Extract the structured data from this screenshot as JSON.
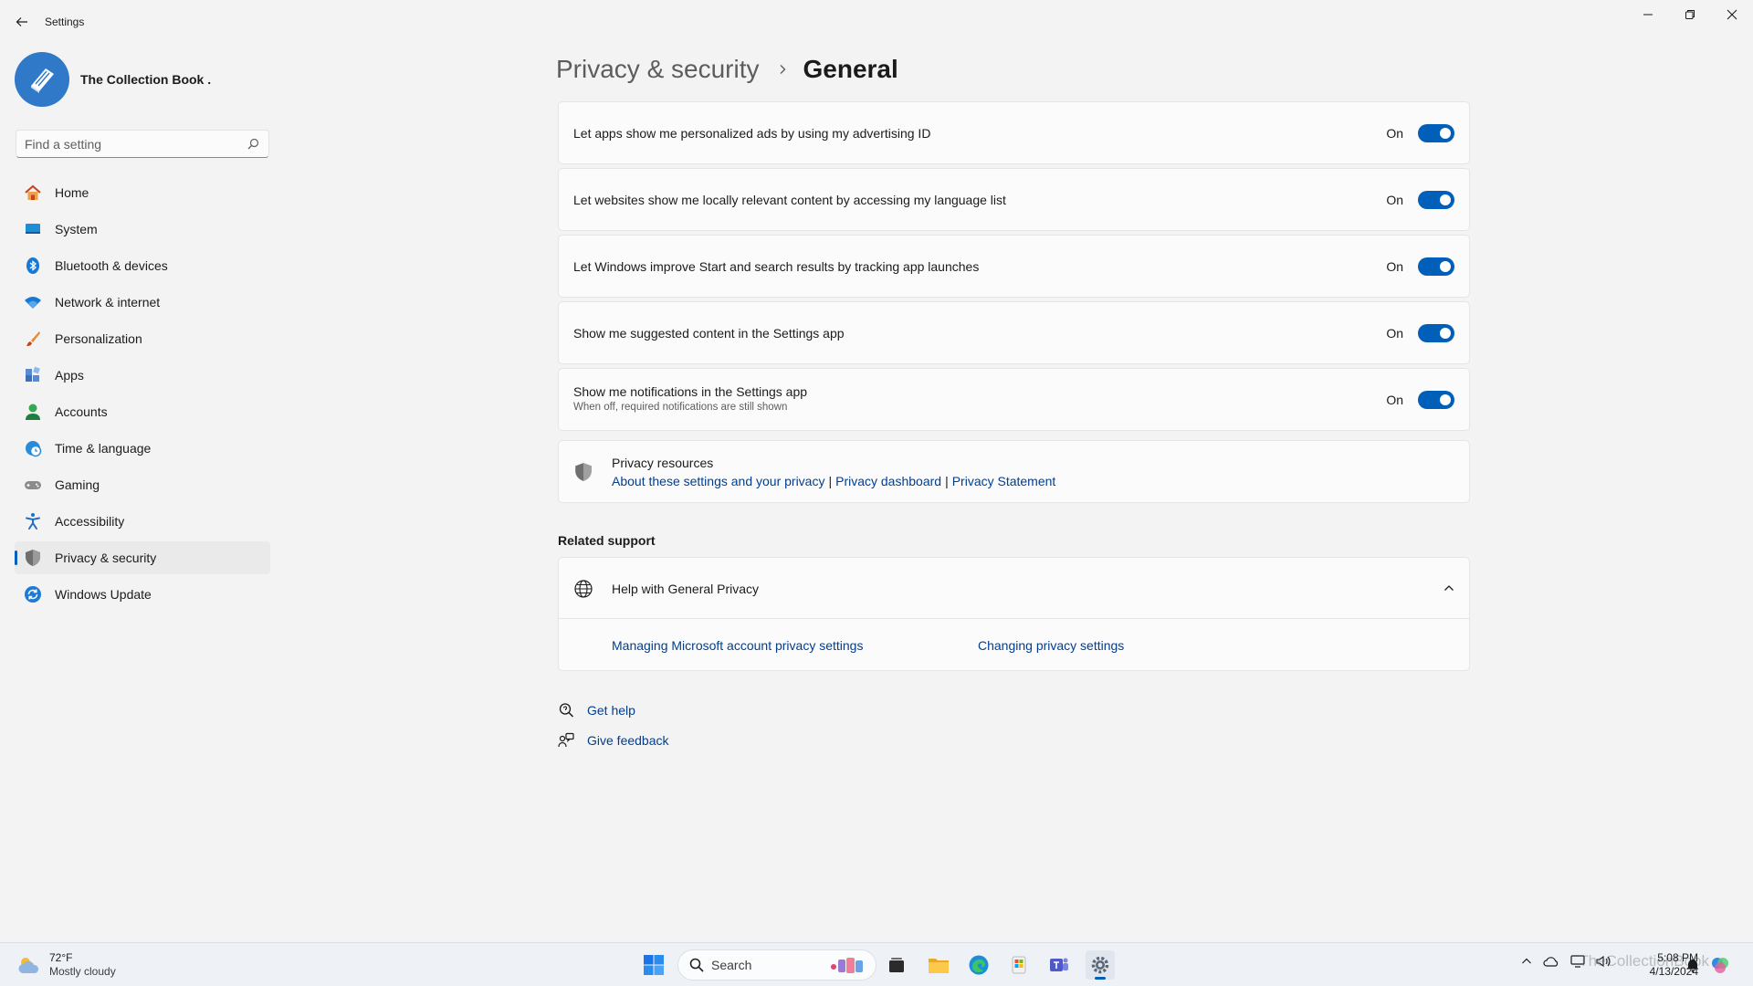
{
  "window": {
    "title": "Settings"
  },
  "profile": {
    "name": "The Collection Book ."
  },
  "search": {
    "placeholder": "Find a setting"
  },
  "nav": [
    {
      "label": "Home",
      "icon": "home-icon"
    },
    {
      "label": "System",
      "icon": "system-icon"
    },
    {
      "label": "Bluetooth & devices",
      "icon": "bluetooth-icon"
    },
    {
      "label": "Network & internet",
      "icon": "wifi-icon"
    },
    {
      "label": "Personalization",
      "icon": "brush-icon"
    },
    {
      "label": "Apps",
      "icon": "apps-icon"
    },
    {
      "label": "Accounts",
      "icon": "accounts-icon"
    },
    {
      "label": "Time & language",
      "icon": "clock-globe-icon"
    },
    {
      "label": "Gaming",
      "icon": "gamepad-icon"
    },
    {
      "label": "Accessibility",
      "icon": "accessibility-icon"
    },
    {
      "label": "Privacy & security",
      "icon": "shield-icon",
      "active": true
    },
    {
      "label": "Windows Update",
      "icon": "update-icon"
    }
  ],
  "breadcrumb": {
    "parent": "Privacy & security",
    "current": "General"
  },
  "settings": [
    {
      "label": "Let apps show me personalized ads by using my advertising ID",
      "state": "On",
      "on": true
    },
    {
      "label": "Let websites show me locally relevant content by accessing my language list",
      "state": "On",
      "on": true
    },
    {
      "label": "Let Windows improve Start and search results by tracking app launches",
      "state": "On",
      "on": true
    },
    {
      "label": "Show me suggested content in the Settings app",
      "state": "On",
      "on": true
    },
    {
      "label": "Show me notifications in the Settings app",
      "description": "When off, required notifications are still shown",
      "state": "On",
      "on": true
    }
  ],
  "privacy_resources": {
    "title": "Privacy resources",
    "links": [
      "About these settings and your privacy",
      "Privacy dashboard",
      "Privacy Statement"
    ],
    "separator": "|"
  },
  "related_support": {
    "title": "Related support",
    "help_title": "Help with General Privacy",
    "links": [
      "Managing Microsoft account privacy settings",
      "Changing privacy settings"
    ]
  },
  "footer": {
    "get_help": "Get help",
    "give_feedback": "Give feedback"
  },
  "taskbar": {
    "weather_temp": "72°F",
    "weather_desc": "Mostly cloudy",
    "search_label": "Search",
    "time": "5:08 PM",
    "date": "4/13/2024",
    "watermark": "TheCollectionBook"
  },
  "colors": {
    "accent": "#005fb8",
    "link": "#003e92",
    "background": "#f3f3f3",
    "card": "#fbfbfb"
  }
}
